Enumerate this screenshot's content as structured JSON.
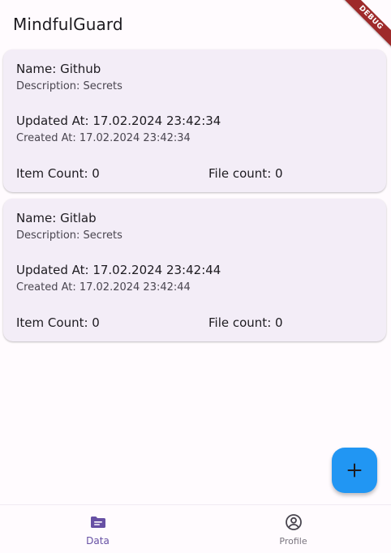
{
  "app": {
    "title": "MindfulGuard",
    "debug_banner": "DEBUG"
  },
  "cards": [
    {
      "name": "Name: Github",
      "description": "Description: Secrets",
      "updated_at": "Updated At: 17.02.2024 23:42:34",
      "created_at": "Created At: 17.02.2024 23:42:34",
      "item_count": "Item Count: 0",
      "file_count": "File count: 0"
    },
    {
      "name": "Name: Gitlab",
      "description": "Description: Secrets",
      "updated_at": "Updated At: 17.02.2024 23:42:44",
      "created_at": "Created At: 17.02.2024 23:42:44",
      "item_count": "Item Count: 0",
      "file_count": "File count: 0"
    }
  ],
  "fab": {
    "icon": "plus-icon"
  },
  "bottom_nav": {
    "items": [
      {
        "label": "Data",
        "icon": "folder-icon",
        "selected": true
      },
      {
        "label": "Profile",
        "icon": "account-circle-icon",
        "selected": false
      }
    ]
  },
  "colors": {
    "background": "#fffbfe",
    "card": "#f3edf7",
    "fab": "#2196f3",
    "accent": "#6750a4",
    "debug_ribbon": "#9e2a2a"
  }
}
